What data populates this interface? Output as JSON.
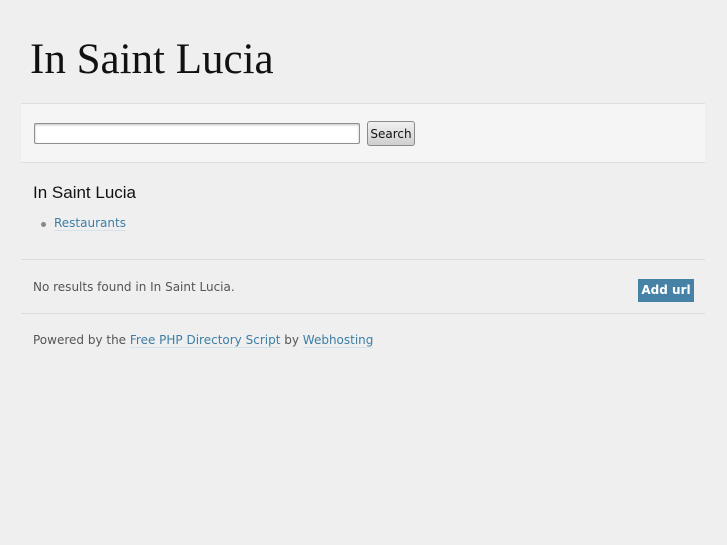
{
  "header": {
    "title": "In Saint Lucia"
  },
  "search": {
    "value": "",
    "placeholder": "",
    "button_label": "Search"
  },
  "category": {
    "heading": "In Saint Lucia",
    "subcategories": [
      {
        "label": "Restaurants"
      }
    ]
  },
  "results": {
    "message": "No results found in In Saint Lucia.",
    "add_url_label": "Add url"
  },
  "footer": {
    "prefix": "Powered by the",
    "script_link": "Free PHP Directory Script",
    "by": "by",
    "host_link": "Webhosting"
  },
  "colors": {
    "background": "#efefef",
    "link": "#3d7ea6",
    "button_accent": "#4682a6"
  }
}
